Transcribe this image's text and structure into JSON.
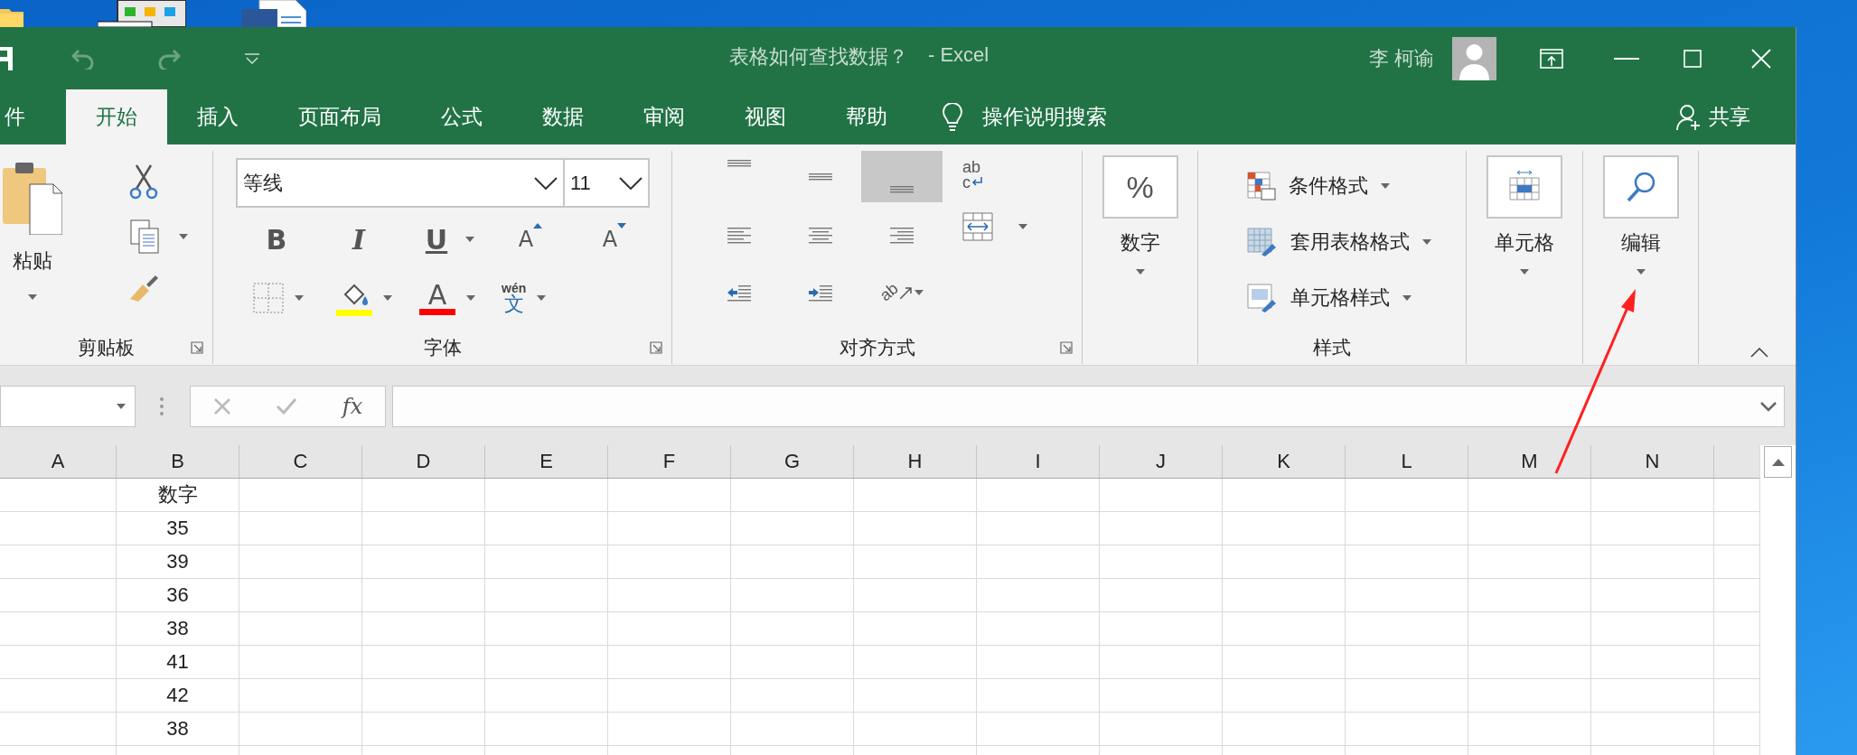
{
  "desktop": {
    "icons": [
      {
        "kind": "folder"
      },
      {
        "kind": "program"
      },
      {
        "kind": "document"
      }
    ]
  },
  "window": {
    "title": "表格如何查找数据？",
    "app": "-  Excel",
    "user": "李 柯谕"
  },
  "tabs": [
    {
      "label": "件",
      "selected": false
    },
    {
      "label": "开始",
      "selected": true
    },
    {
      "label": "插入",
      "selected": false
    },
    {
      "label": "页面布局",
      "selected": false
    },
    {
      "label": "公式",
      "selected": false
    },
    {
      "label": "数据",
      "selected": false
    },
    {
      "label": "审阅",
      "selected": false
    },
    {
      "label": "视图",
      "selected": false
    },
    {
      "label": "帮助",
      "selected": false
    }
  ],
  "tell_me": "操作说明搜索",
  "share": "共享",
  "ribbon": {
    "clipboard": {
      "label": "剪贴板",
      "paste": "粘贴"
    },
    "font": {
      "label": "字体",
      "font_name": "等线",
      "font_size": "11",
      "bold": "B",
      "italic": "I",
      "underline": "U",
      "grow": "A",
      "shrink": "A",
      "font_color": "A",
      "phonetic_top": "wén",
      "phonetic_char": "文"
    },
    "alignment": {
      "label": "对齐方式",
      "buttons": [
        {
          "kind": "top",
          "selected": false
        },
        {
          "kind": "middle",
          "selected": false
        },
        {
          "kind": "bottom",
          "selected": true
        },
        {
          "kind": "left",
          "selected": false
        },
        {
          "kind": "center",
          "selected": false
        },
        {
          "kind": "right",
          "selected": false
        },
        {
          "kind": "outdent",
          "selected": false
        },
        {
          "kind": "indent",
          "selected": false
        },
        {
          "kind": "orientation",
          "selected": false,
          "glyph": "ab"
        }
      ],
      "wrap_top": "ab",
      "wrap_bottom": "c"
    },
    "number": {
      "label": "数字",
      "symbol": "%"
    },
    "styles": {
      "label": "样式",
      "items": [
        {
          "kind": "conditional",
          "label": "条件格式"
        },
        {
          "kind": "table",
          "label": "套用表格格式"
        },
        {
          "kind": "cell",
          "label": "单元格样式"
        }
      ]
    },
    "cells": {
      "label": "单元格"
    },
    "editing": {
      "label": "编辑"
    }
  },
  "formula_bar": {
    "function_symbol": "fx"
  },
  "sheet": {
    "columns": [
      "A",
      "B",
      "C",
      "D",
      "E",
      "F",
      "G",
      "H",
      "I",
      "J",
      "K",
      "L",
      "M",
      "N"
    ],
    "column_b": [
      "数字",
      "35",
      "39",
      "36",
      "38",
      "41",
      "42",
      "38"
    ]
  }
}
